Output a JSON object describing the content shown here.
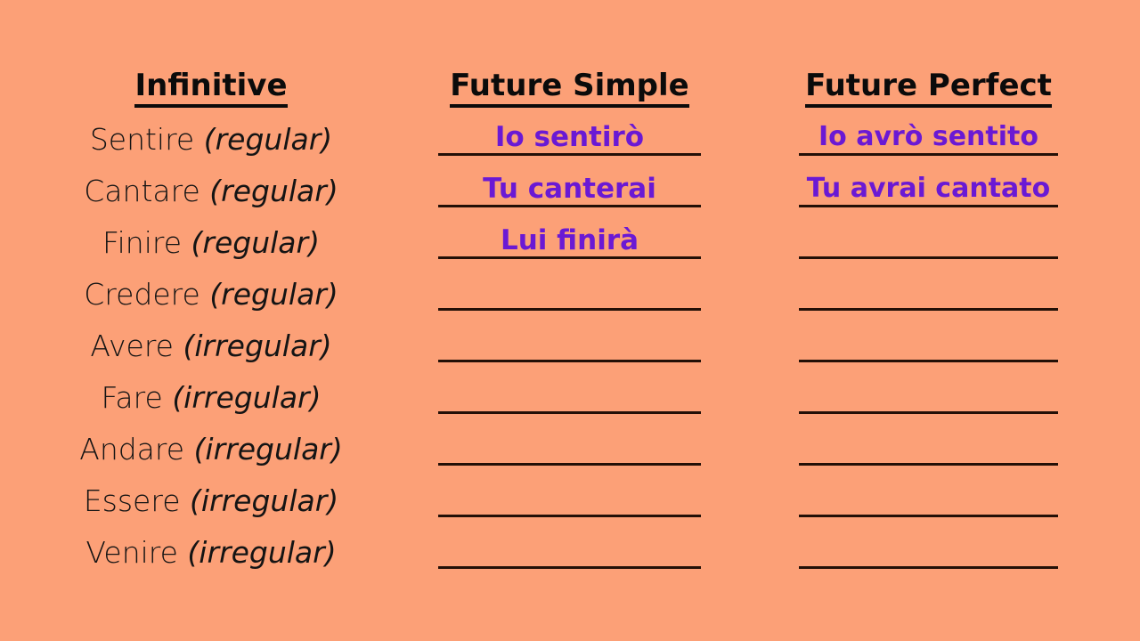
{
  "page": {
    "background_color": "#fca077",
    "ink_color": "#231007",
    "heading_color": "#0b0b0b",
    "answer_color": "#6a19d4"
  },
  "columns": {
    "infinitive": {
      "heading": "Infinitive",
      "rows": [
        {
          "verb": "Sentire",
          "kind": "(regular)"
        },
        {
          "verb": "Cantare",
          "kind": "(regular)"
        },
        {
          "verb": "Finire",
          "kind": "(regular)"
        },
        {
          "verb": "Credere",
          "kind": "(regular)"
        },
        {
          "verb": "Avere",
          "kind": "(irregular)"
        },
        {
          "verb": "Fare",
          "kind": "(irregular)"
        },
        {
          "verb": "Andare",
          "kind": "(irregular)"
        },
        {
          "verb": "Essere",
          "kind": "(irregular)"
        },
        {
          "verb": "Venire",
          "kind": "(irregular)"
        }
      ]
    },
    "future_simple": {
      "heading": "Future Simple",
      "answers": [
        "Io sentirò",
        "Tu canterai",
        "Lui finirà",
        "",
        "",
        "",
        "",
        "",
        ""
      ]
    },
    "future_perfect": {
      "heading": "Future Perfect",
      "answers": [
        "Io avrò sentito",
        "Tu avrai cantato",
        "",
        "",
        "",
        "",
        "",
        "",
        ""
      ]
    }
  }
}
